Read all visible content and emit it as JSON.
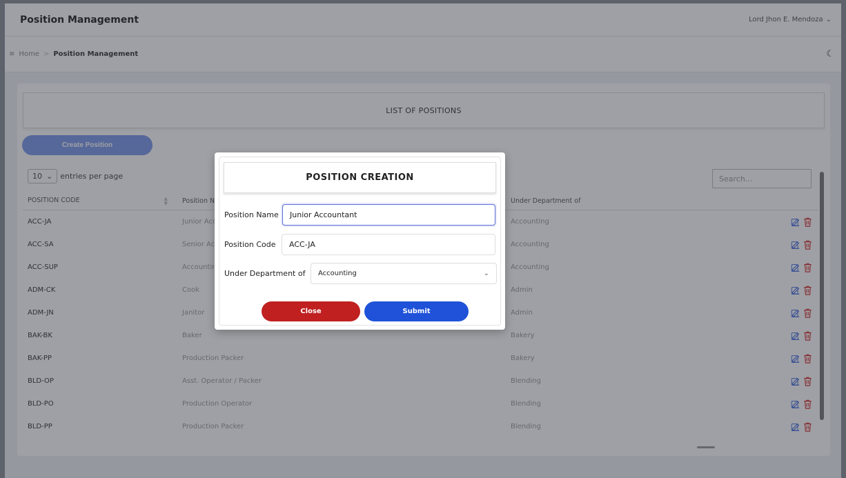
{
  "header": {
    "title": "Position Management",
    "user": "Lord Jhon E. Mendoza"
  },
  "breadcrumb": {
    "home": "Home",
    "current": "Position Management"
  },
  "list": {
    "title": "LIST OF POSITIONS",
    "create_button": "Create Position",
    "entries_value": "10",
    "entries_label": "entries per page",
    "search_placeholder": "Search...",
    "columns": {
      "code": "POSITION CODE",
      "name": "Position Name",
      "dept": "Under Department of"
    },
    "rows": [
      {
        "code": "ACC-JA",
        "name": "Junior Accountant",
        "dept": "Accounting"
      },
      {
        "code": "ACC-SA",
        "name": "Senior Accountant",
        "dept": "Accounting"
      },
      {
        "code": "ACC-SUP",
        "name": "Accounting Supervisor",
        "dept": "Accounting"
      },
      {
        "code": "ADM-CK",
        "name": "Cook",
        "dept": "Admin"
      },
      {
        "code": "ADM-JN",
        "name": "Janitor",
        "dept": "Admin"
      },
      {
        "code": "BAK-BK",
        "name": "Baker",
        "dept": "Bakery"
      },
      {
        "code": "BAK-PP",
        "name": "Production Packer",
        "dept": "Bakery"
      },
      {
        "code": "BLD-OP",
        "name": "Asst. Operator / Packer",
        "dept": "Blending"
      },
      {
        "code": "BLD-PO",
        "name": "Production Operator",
        "dept": "Blending"
      },
      {
        "code": "BLD-PP",
        "name": "Production Packer",
        "dept": "Blending"
      }
    ]
  },
  "modal": {
    "title": "POSITION CREATION",
    "position_name_label": "Position Name",
    "position_name_value": "Junior Accountant",
    "position_code_label": "Position Code",
    "position_code_value": "ACC-JA",
    "department_label": "Under Department of",
    "department_value": "Accounting",
    "close_label": "Close",
    "submit_label": "Submit"
  },
  "colors": {
    "close": "#c02020",
    "submit": "#1f52d8",
    "create": "#7c97ea",
    "edit_icon": "#4a6ee0",
    "delete_icon": "#d33030"
  }
}
